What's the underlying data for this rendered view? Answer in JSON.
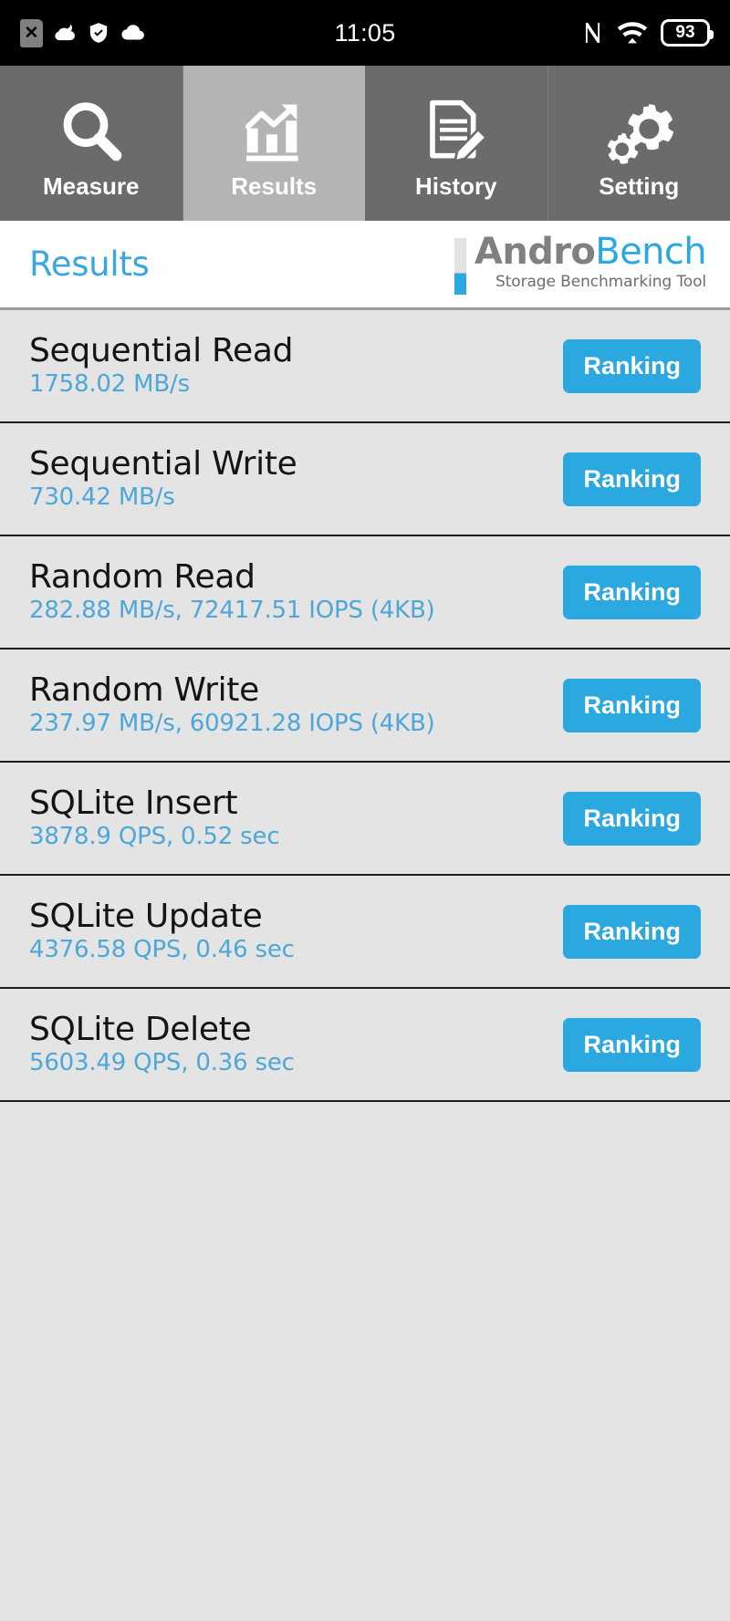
{
  "status_bar": {
    "clock": "11:05",
    "battery_percent": "93",
    "left_icons": [
      "sim-card-x-icon",
      "weather-cloud-icon",
      "shield-check-icon",
      "cloud-icon"
    ],
    "right_icons": [
      "nfc-icon",
      "wifi-icon",
      "battery-icon"
    ]
  },
  "tabs": [
    {
      "label": "Measure",
      "icon": "magnifier-icon",
      "active": false
    },
    {
      "label": "Results",
      "icon": "bar-chart-icon",
      "active": true
    },
    {
      "label": "History",
      "icon": "document-pencil-icon",
      "active": false
    },
    {
      "label": "Setting",
      "icon": "gears-icon",
      "active": false
    }
  ],
  "header": {
    "title": "Results",
    "logo_primary": "Andro",
    "logo_secondary": "Bench",
    "logo_subtitle": "Storage Benchmarking Tool"
  },
  "colors": {
    "accent_blue": "#2ba8e0",
    "value_blue": "#4da7d8",
    "tab_inactive": "#6b6b6b",
    "tab_active": "#b4b4b4",
    "list_bg": "#e4e4e4"
  },
  "results": [
    {
      "title": "Sequential Read",
      "value": "1758.02 MB/s",
      "button": "Ranking"
    },
    {
      "title": "Sequential Write",
      "value": "730.42 MB/s",
      "button": "Ranking"
    },
    {
      "title": "Random Read",
      "value": "282.88 MB/s, 72417.51 IOPS (4KB)",
      "button": "Ranking"
    },
    {
      "title": "Random Write",
      "value": "237.97 MB/s, 60921.28 IOPS (4KB)",
      "button": "Ranking"
    },
    {
      "title": "SQLite Insert",
      "value": "3878.9 QPS, 0.52 sec",
      "button": "Ranking"
    },
    {
      "title": "SQLite Update",
      "value": "4376.58 QPS, 0.46 sec",
      "button": "Ranking"
    },
    {
      "title": "SQLite Delete",
      "value": "5603.49 QPS, 0.36 sec",
      "button": "Ranking"
    }
  ]
}
